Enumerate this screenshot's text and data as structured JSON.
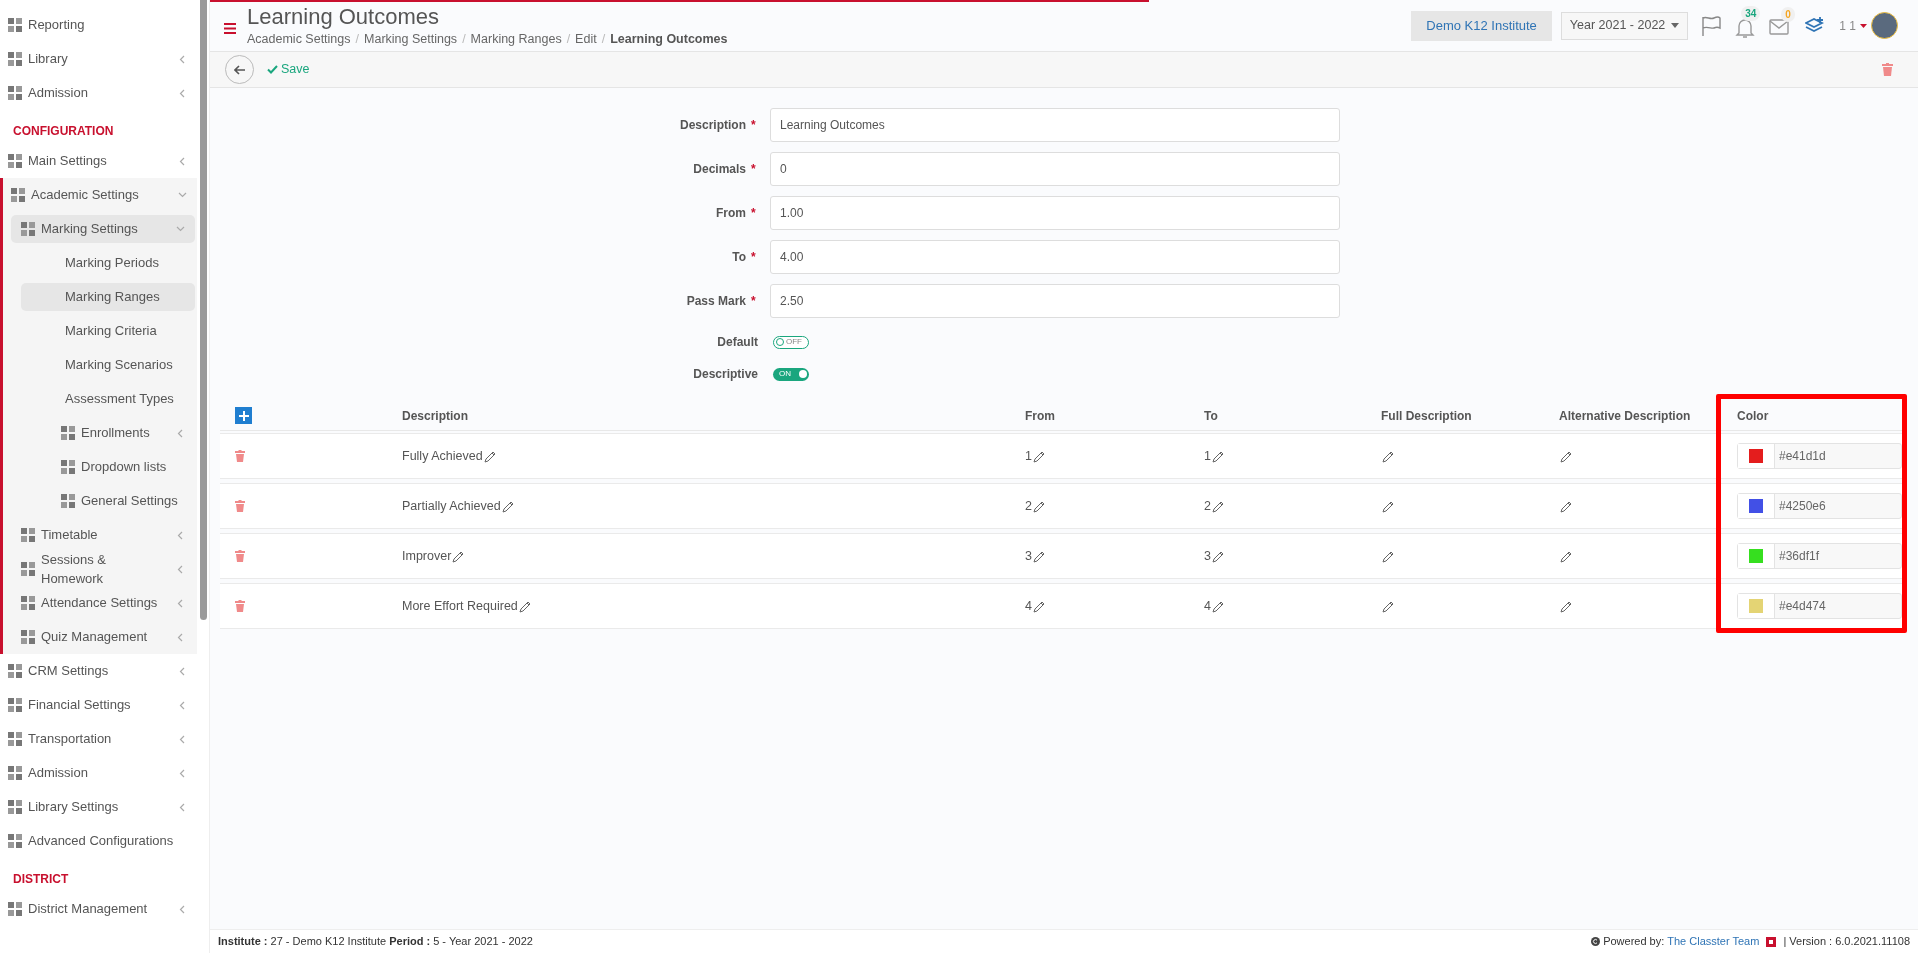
{
  "sidebar": {
    "items": [
      {
        "kind": "icon",
        "label": "Reporting",
        "selected": false
      },
      {
        "kind": "icon",
        "label": "Library",
        "selected": false,
        "expanded": false
      },
      {
        "kind": "icon",
        "label": "Admission",
        "selected": false,
        "expanded": false
      },
      {
        "kind": "section",
        "label": "CONFIGURATION"
      },
      {
        "kind": "icon",
        "label": "Main Settings",
        "selected": false,
        "expanded": false
      },
      {
        "kind": "icon",
        "label": "Academic Settings",
        "selected": false,
        "expanded": true,
        "children": [
          {
            "kind": "icon",
            "label": "Marking Settings",
            "selected": true,
            "expanded": true,
            "children": [
              {
                "kind": "plain",
                "label": "Marking Periods",
                "selected": false
              },
              {
                "kind": "plain",
                "label": "Marking Ranges",
                "selected": true
              },
              {
                "kind": "plain",
                "label": "Marking Criteria",
                "selected": false
              },
              {
                "kind": "plain",
                "label": "Marking Scenarios",
                "selected": false
              },
              {
                "kind": "plain",
                "label": "Assessment Types",
                "selected": false
              },
              {
                "kind": "icon",
                "label": "Enrollments",
                "selected": false,
                "expanded": false
              },
              {
                "kind": "icon",
                "label": "Dropdown lists",
                "selected": false
              },
              {
                "kind": "icon",
                "label": "General Settings",
                "selected": false
              }
            ]
          },
          {
            "kind": "icon",
            "label": "Timetable",
            "selected": false,
            "expanded": false
          },
          {
            "kind": "icon",
            "label": "Sessions & Homework",
            "selected": false,
            "expanded": false
          },
          {
            "kind": "icon",
            "label": "Attendance Settings",
            "selected": false,
            "expanded": false
          },
          {
            "kind": "icon",
            "label": "Quiz Management",
            "selected": false,
            "expanded": false
          }
        ]
      },
      {
        "kind": "icon",
        "label": "CRM Settings",
        "selected": false,
        "expanded": false
      },
      {
        "kind": "icon",
        "label": "Financial Settings",
        "selected": false,
        "expanded": false
      },
      {
        "kind": "icon",
        "label": "Transportation",
        "selected": false,
        "expanded": false
      },
      {
        "kind": "icon",
        "label": "Admission",
        "selected": false,
        "expanded": false
      },
      {
        "kind": "icon",
        "label": "Library Settings",
        "selected": false,
        "expanded": false
      },
      {
        "kind": "icon",
        "label": "Advanced Configurations",
        "selected": false
      },
      {
        "kind": "section",
        "label": "DISTRICT"
      },
      {
        "kind": "icon",
        "label": "District Management",
        "selected": false,
        "expanded": false
      }
    ]
  },
  "loading_bar": {
    "level": 0.55
  },
  "header": {
    "title": "Learning Outcomes",
    "breadcrumbs": [
      {
        "label": "Academic Settings",
        "current": false
      },
      {
        "label": "Marking Settings",
        "current": false
      },
      {
        "label": "Marking Ranges",
        "current": false
      },
      {
        "label": "Edit",
        "current": false
      },
      {
        "label": "Learning Outcomes",
        "current": true
      }
    ],
    "breadcrumb_separators": [
      "/",
      "/",
      "/",
      "/"
    ],
    "institute": "Demo K12 Institute",
    "year": "Year 2021 - 2022",
    "notifications": "34",
    "messages": "0",
    "user": "1 1"
  },
  "toolbar": {
    "save": "Save"
  },
  "form": {
    "fields": [
      {
        "label": "Description",
        "required_mark": "*",
        "value": "Learning Outcomes"
      },
      {
        "label": "Decimals",
        "required_mark": "*",
        "value": "0"
      },
      {
        "label": "From",
        "required_mark": "*",
        "value": "1.00"
      },
      {
        "label": "To",
        "required_mark": "*",
        "value": "4.00"
      },
      {
        "label": "Pass Mark",
        "required_mark": "*",
        "value": "2.50"
      }
    ],
    "toggles": [
      {
        "label": "Default",
        "on": false,
        "text": "OFF"
      },
      {
        "label": "Descriptive",
        "on": true,
        "text": "ON"
      }
    ]
  },
  "table": {
    "columns": [
      "Description",
      "From",
      "To",
      "Full Description",
      "Alternative Description",
      "Color"
    ],
    "rows": [
      {
        "description": "Fully Achieved",
        "from": "1",
        "to": "1",
        "color": "#e41d1d"
      },
      {
        "description": "Partially Achieved",
        "from": "2",
        "to": "2",
        "color": "#4250e6"
      },
      {
        "description": "Improver",
        "from": "3",
        "to": "3",
        "color": "#36df1f"
      },
      {
        "description": "More Effort Required",
        "from": "4",
        "to": "4",
        "color": "#e4d474"
      }
    ]
  },
  "footer": {
    "info": "**Institute :** 27 - Demo K12 Institute **Period :** 5 - Year 2021 - 2022",
    "powered_by": "Powered by:",
    "team_link": "The Classter Team",
    "version": "| Version : 6.0.2021.11108"
  }
}
